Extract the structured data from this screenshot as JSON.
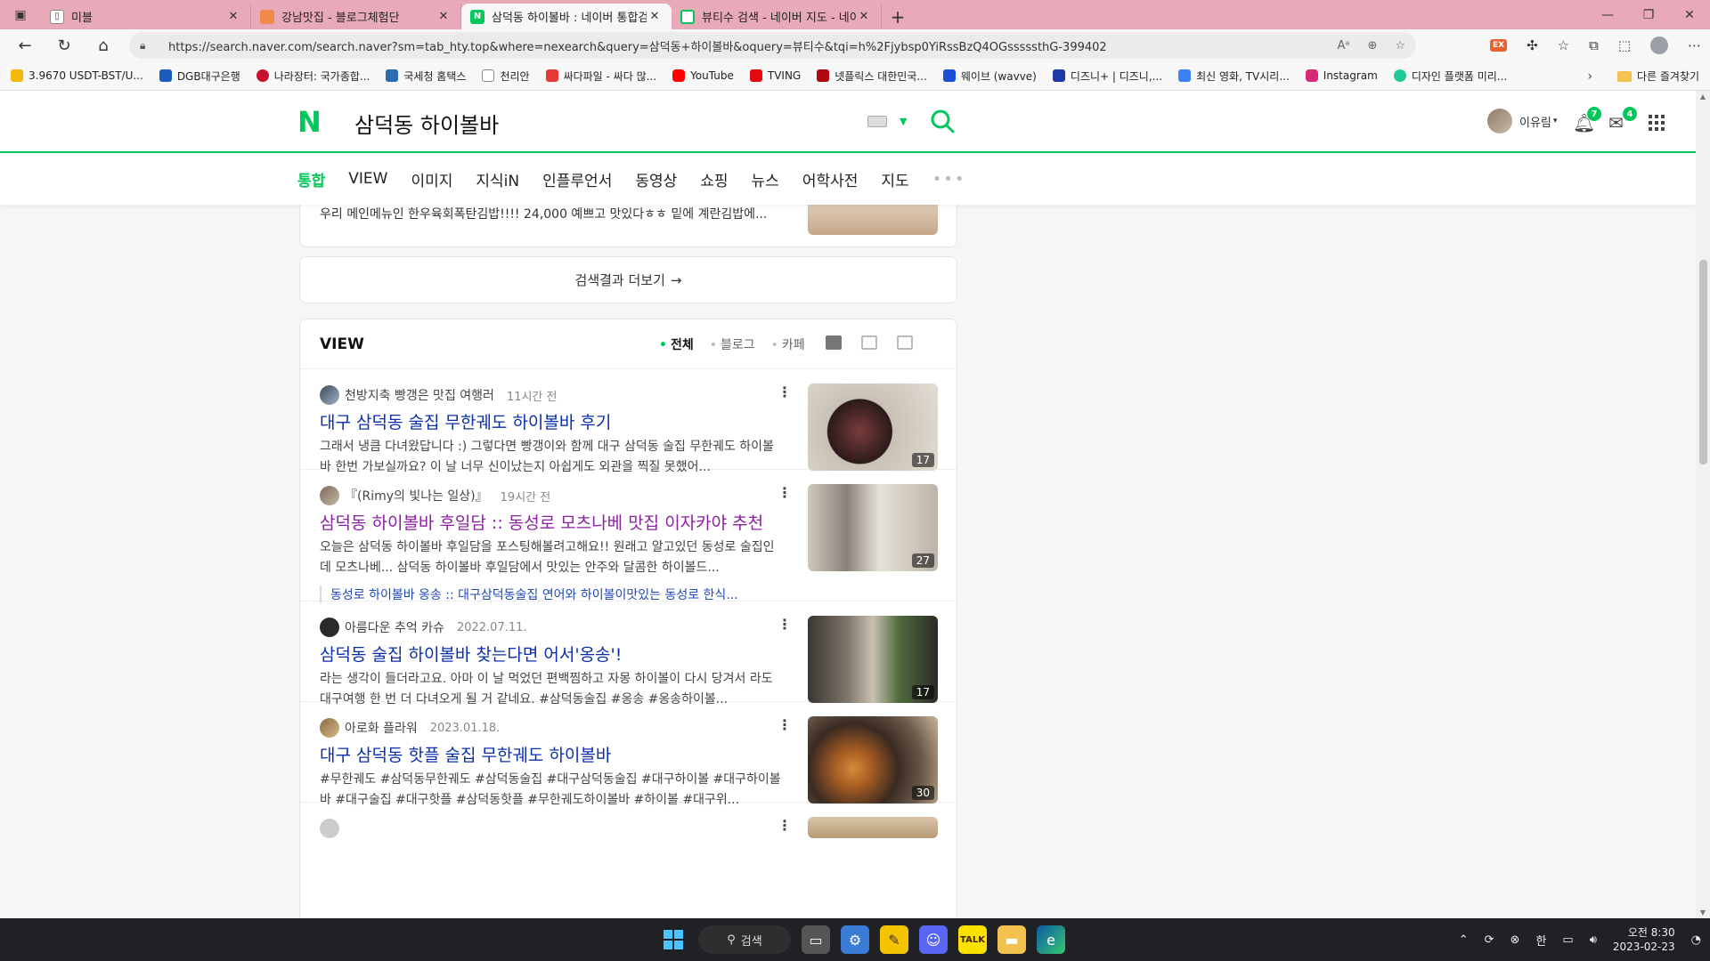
{
  "browser": {
    "tabs": [
      {
        "title": "미블",
        "active": false
      },
      {
        "title": "강남맛집 - 블로그체험단",
        "active": false
      },
      {
        "title": "삼덕동 하이볼바 : 네이버 통합검",
        "active": true
      },
      {
        "title": "뷰티수 검색 - 네이버 지도 - 네이",
        "active": false
      }
    ],
    "url": "https://search.naver.com/search.naver?sm=tab_hty.top&where=nexearch&query=삼덕동+하이볼바&oquery=뷰티수&tqi=h%2Fjybsp0YiRssBzQ4OGsssssthG-399402",
    "bookmarks": [
      {
        "label": "3.9670 USDT-BST/U...",
        "color": "#f0b90b"
      },
      {
        "label": "DGB대구은행",
        "color": "#1e5bbf"
      },
      {
        "label": "나라장터: 국가종합...",
        "color": "#c8102e"
      },
      {
        "label": "국세청 홈택스",
        "color": "#2b6cb0"
      },
      {
        "label": "천리안",
        "color": "#999999"
      },
      {
        "label": "싸다파일 - 싸다 많...",
        "color": "#e53935"
      },
      {
        "label": "YouTube",
        "color": "#ff0000"
      },
      {
        "label": "TVING",
        "color": "#e50914"
      },
      {
        "label": "넷플릭스 대한민국...",
        "color": "#b20710"
      },
      {
        "label": "웨이브 (wavve)",
        "color": "#1a4fd6"
      },
      {
        "label": "디즈니+ | 디즈니,...",
        "color": "#1d3aa8"
      },
      {
        "label": "최신 영화, TV시리...",
        "color": "#3b82f6"
      },
      {
        "label": "Instagram",
        "color": "#d62976"
      },
      {
        "label": "디자인 플랫폼 미리...",
        "color": "#20c997"
      }
    ],
    "other_bookmarks": "다른 즐겨찾기"
  },
  "naver": {
    "query": "삼덕동 하이볼바",
    "user": "이유림",
    "notif_count": "7",
    "mail_count": "4",
    "nav": [
      "통합",
      "VIEW",
      "이미지",
      "지식iN",
      "인플루언서",
      "동영상",
      "쇼핑",
      "뉴스",
      "어학사전",
      "지도"
    ],
    "prev_snippet": "우리 메인메뉴인 한우육회폭탄김밥!!!! 24,000 예쁘고 맛있다ㅎㅎ 밑에 계란김밥에...",
    "more_results": "검색결과 더보기",
    "view": {
      "title": "VIEW",
      "filters": [
        "전체",
        "블로그",
        "카페"
      ],
      "items": [
        {
          "author": "천방지축 빵갱은 맛집 여행러",
          "time": "11시간 전",
          "title": "대구 삼덕동 술집 무한궤도 하이볼바 후기",
          "desc": "그래서 냉큼 다녀왔답니다 :) 그렇다면 빵갱이와 함께 대구 삼덕동 술집 무한궤도 하이볼바 한번 가보실까요? 이 날 너무 신이났는지 아쉽게도 외관을 찍질 못했어...",
          "count": "17"
        },
        {
          "author": "『(Rimy의 빛나는 일상)』",
          "time": "19시간 전",
          "title": "삼덕동 하이볼바 후일담 :: 동성로 모츠나베 맛집 이자카야 추천",
          "desc": "오늘은 삼덕동 하이볼바 후일담을 포스팅해볼려고해요!! 원래고 알고있던 동성로 술집인데 모츠나베... 삼덕동 하이볼바 후일담에서 맛있는 안주와 달콤한 하이볼드...",
          "sub": "동성로 하이볼바 옹송 :: 대구삼덕동술집 연어와 하이볼이맛있는 동성로 한식...",
          "count": "27"
        },
        {
          "author": "아름다운 추억 카슈",
          "time": "2022.07.11.",
          "title": "삼덕동 술집 하이볼바 찾는다면 어서'옹송'!",
          "desc": "라는 생각이 들더라고요. 아마 이 날 먹었던 편백찜하고 자몽 하이볼이 다시 당겨서 라도 대구여행 한 번 더 다녀오게 될 거 같네요. #삼덕동술집 #옹송 #옹송하이볼...",
          "count": "17"
        },
        {
          "author": "아로화 플라워",
          "time": "2023.01.18.",
          "title": "대구 삼덕동 핫플 술집 무한궤도 하이볼바",
          "desc": "#무한궤도 #삼덕동무한궤도 #삼덕동술집 #대구삼덕동술집 #대구하이볼 #대구하이볼바 #대구술집 #대구핫플 #삼덕동핫플 #무한궤도하이볼바 #하이볼 #대구위...",
          "count": "30"
        }
      ]
    }
  },
  "taskbar": {
    "search": "검색",
    "ime": "한",
    "time": "오전 8:30",
    "date": "2023-02-23"
  }
}
